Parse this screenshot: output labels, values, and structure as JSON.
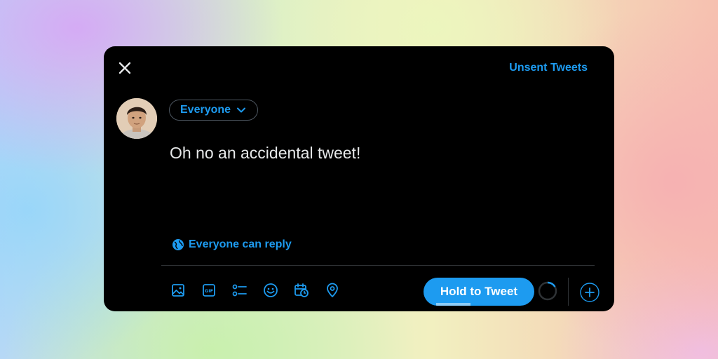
{
  "header": {
    "unsent_label": "Unsent Tweets"
  },
  "composer": {
    "audience_label": "Everyone",
    "text": "Oh no an accidental tweet!",
    "reply_setting_label": "Everyone can reply"
  },
  "toolbar": {
    "icons": [
      "image-icon",
      "gif-icon",
      "poll-icon",
      "emoji-icon",
      "schedule-icon",
      "location-icon"
    ],
    "gif_text": "GIF"
  },
  "tweet_button": {
    "label": "Hold to Tweet",
    "hold_progress": 0.4
  },
  "colors": {
    "accent": "#1d9bf0",
    "background": "#000000",
    "text": "#e7e9ea",
    "border": "#2f3336"
  }
}
